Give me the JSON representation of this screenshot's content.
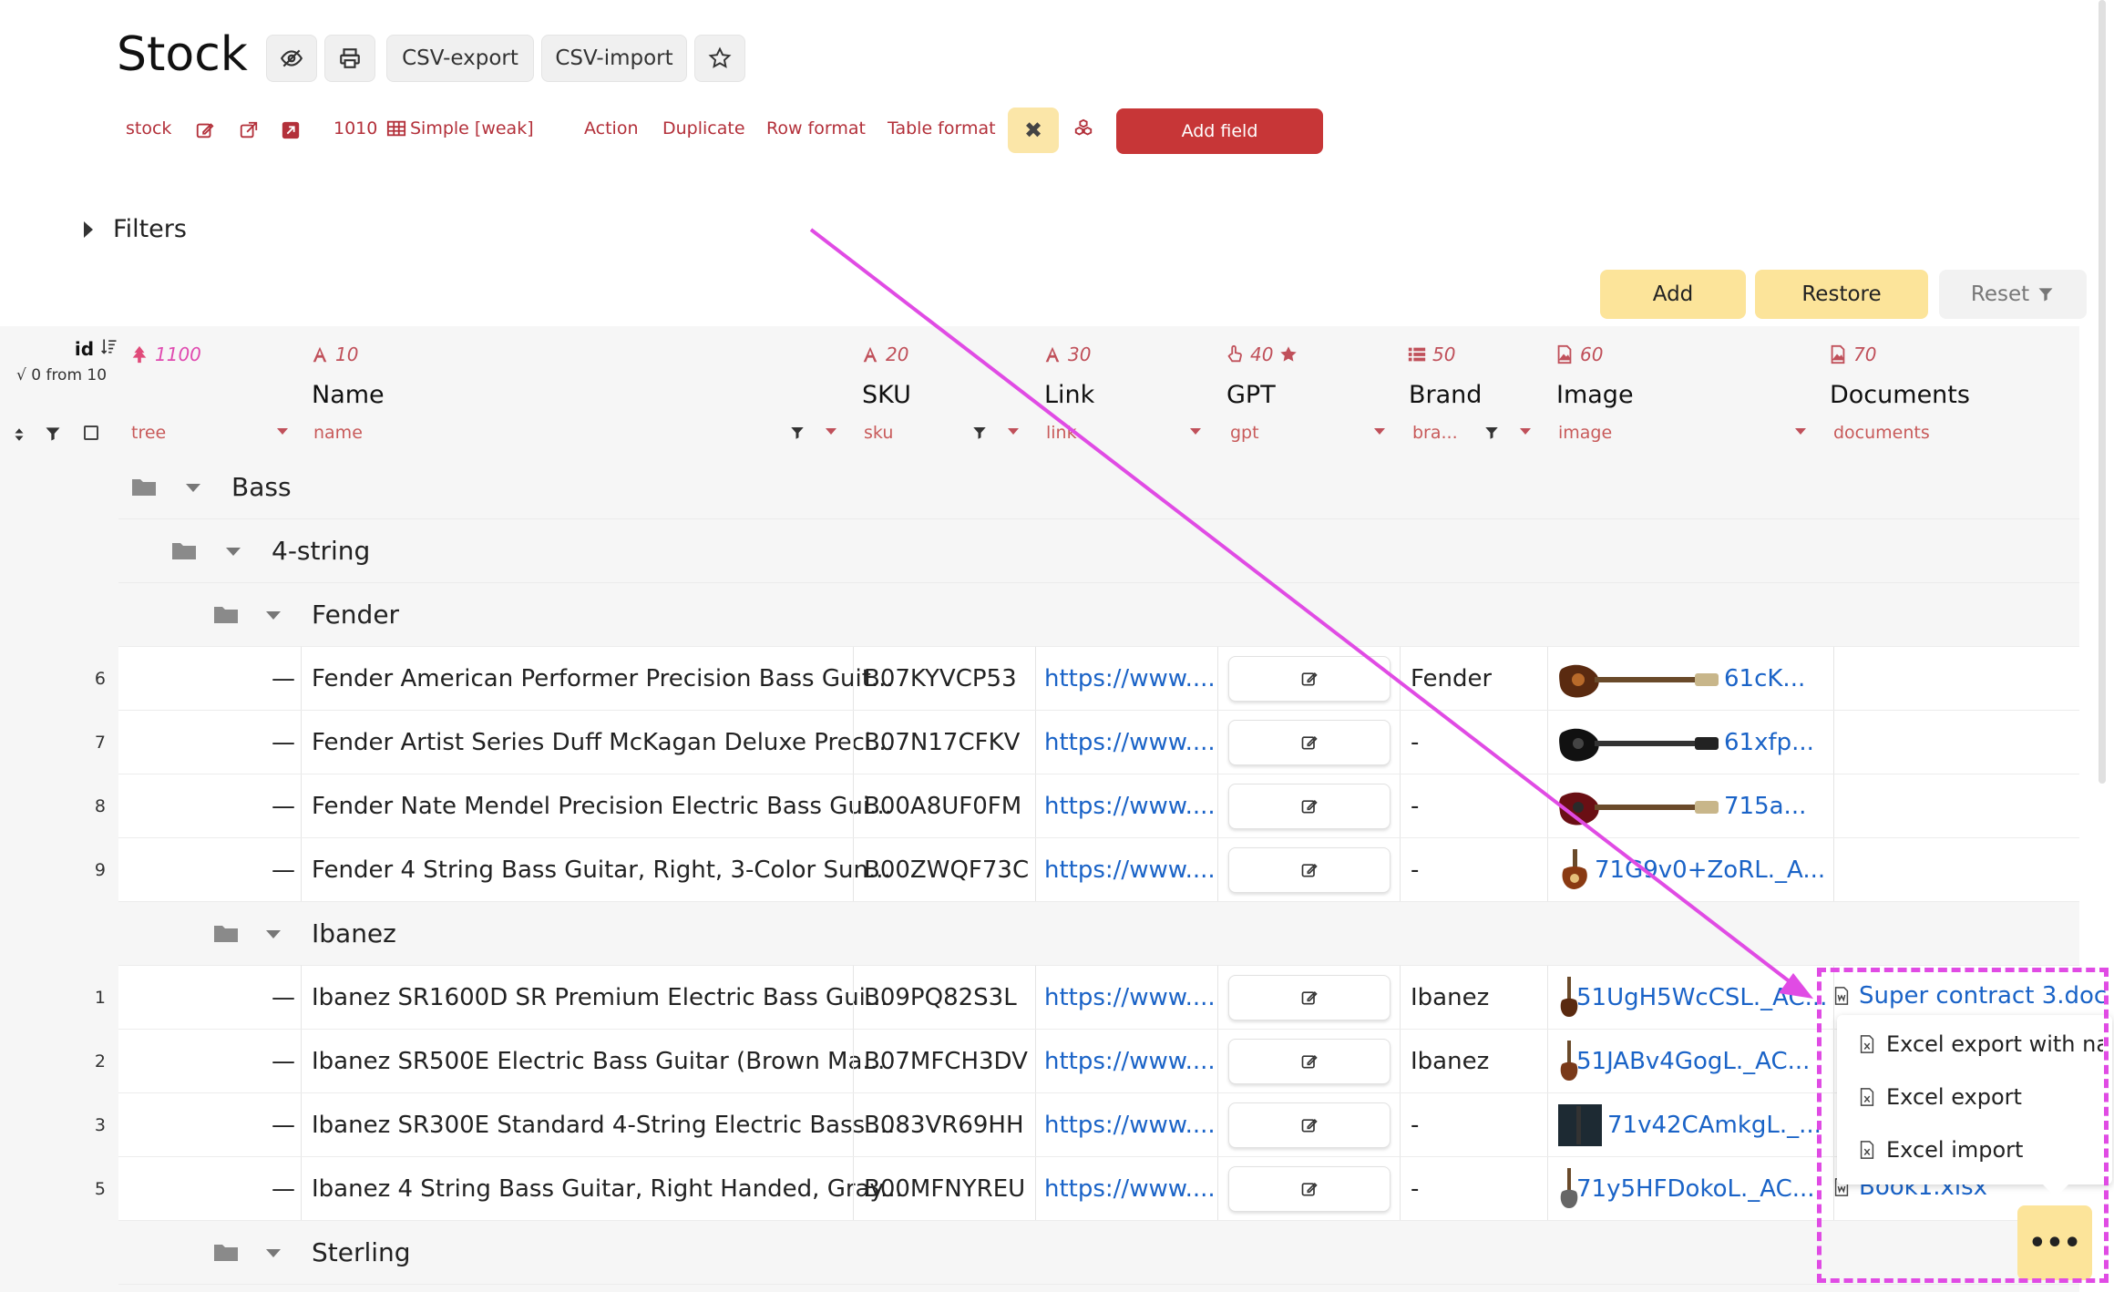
{
  "page": {
    "title": "Stock"
  },
  "toolbar": {
    "csv_export": "CSV-export",
    "csv_import": "CSV-import"
  },
  "subtoolbar": {
    "table_name": "stock",
    "table_id": "1010",
    "table_type": "Simple [weak]",
    "action": "Action",
    "duplicate": "Duplicate",
    "row_format": "Row format",
    "table_format": "Table format",
    "clear_symbol": "✖",
    "add_field": "Add field"
  },
  "filters": {
    "label": "Filters"
  },
  "actions": {
    "add": "Add",
    "restore": "Restore",
    "reset": "Reset"
  },
  "grid": {
    "id_header": "id",
    "id_sub": "√ 0 from 10",
    "columns": [
      {
        "num": "1100",
        "title": "",
        "field": "tree"
      },
      {
        "num": "10",
        "title": "Name",
        "field": "name"
      },
      {
        "num": "20",
        "title": "SKU",
        "field": "sku"
      },
      {
        "num": "30",
        "title": "Link",
        "field": "link"
      },
      {
        "num": "40",
        "title": "GPT",
        "field": "gpt"
      },
      {
        "num": "50",
        "title": "Brand",
        "field": "bra..."
      },
      {
        "num": "60",
        "title": "Image",
        "field": "image"
      },
      {
        "num": "70",
        "title": "Documents",
        "field": "documents"
      }
    ],
    "groups": {
      "bass": "Bass",
      "four_string": "4-string",
      "fender": "Fender",
      "ibanez": "Ibanez",
      "sterling": "Sterling"
    },
    "rows": [
      {
        "id": "6",
        "dash": "—",
        "name": "Fender American Performer Precision Bass Guit...",
        "sku": "B07KYVCP53",
        "link": "https://www....",
        "brand": "Fender",
        "image": "61cK..."
      },
      {
        "id": "7",
        "dash": "—",
        "name": "Fender Artist Series Duff McKagan Deluxe Preci...",
        "sku": "B07N17CFKV",
        "link": "https://www....",
        "brand": "-",
        "image": "61xfp..."
      },
      {
        "id": "8",
        "dash": "—",
        "name": "Fender Nate Mendel Precision Electric Bass Gui...",
        "sku": "B00A8UF0FM",
        "link": "https://www....",
        "brand": "-",
        "image": "715a..."
      },
      {
        "id": "9",
        "dash": "—",
        "name": "Fender 4 String Bass Guitar, Right, 3-Color Sun...",
        "sku": "B00ZWQF73C",
        "link": "https://www....",
        "brand": "-",
        "image": "71G9v0+ZoRL._A..."
      },
      {
        "id": "1",
        "dash": "—",
        "name": "Ibanez SR1600D SR Premium Electric Bass Gui...",
        "sku": "B09PQ82S3L",
        "link": "https://www....",
        "brand": "Ibanez",
        "image": "51UgH5WcCSL._AC..."
      },
      {
        "id": "2",
        "dash": "—",
        "name": "Ibanez SR500E Electric Bass Guitar (Brown Ma...",
        "sku": "B07MFCH3DV",
        "link": "https://www....",
        "brand": "Ibanez",
        "image": "51JABv4GogL._AC..."
      },
      {
        "id": "3",
        "dash": "—",
        "name": "Ibanez SR300E Standard 4-String Electric Bass ...",
        "sku": "B083VR69HH",
        "link": "https://www....",
        "brand": "-",
        "image": "71v42CAmkgL._..."
      },
      {
        "id": "5",
        "dash": "—",
        "name": "Ibanez 4 String Bass Guitar, Right Handed, Gray...",
        "sku": "B00MFNYREU",
        "link": "https://www....",
        "brand": "-",
        "image": "71y5HFDokoL._AC..."
      }
    ],
    "documents": {
      "row1": "Super contract 3.doc",
      "row5": "Book1.xlsx"
    }
  },
  "menu": {
    "items": [
      "Excel export with na...",
      "Excel export",
      "Excel import"
    ],
    "more": "•••"
  },
  "colors": {
    "accent_red": "#c73637",
    "accent_yellow": "#fce49a",
    "link_blue": "#1a63c7",
    "annotation_magenta": "#e04be4"
  }
}
